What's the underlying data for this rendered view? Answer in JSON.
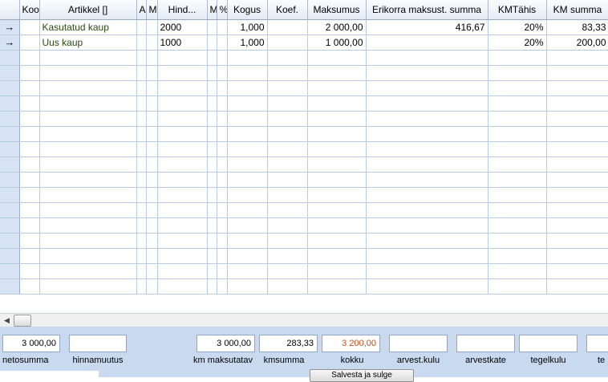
{
  "grid": {
    "columns": [
      "Koo",
      "Artikkel []",
      "A",
      "M",
      "Hind...",
      "M",
      "%",
      "Kogus",
      "Koef.",
      "Maksumus",
      "Erikorra maksust. summa",
      "KMTähis",
      "KM summa"
    ],
    "rows": [
      {
        "indicator": "→",
        "koo": "",
        "artikkel": "Kasutatud kaup",
        "a": "",
        "m": "",
        "hind": "2000",
        "m2": "",
        "pct": "",
        "kogus": "1,000",
        "koef": "",
        "maksumus": "2 000,00",
        "erikorra": "416,67",
        "kmtahis": "20%",
        "kmsumma": "83,33"
      },
      {
        "indicator": "→",
        "koo": "",
        "artikkel": "Uus kaup",
        "a": "",
        "m": "",
        "hind": "1000",
        "m2": "",
        "pct": "",
        "kogus": "1,000",
        "koef": "",
        "maksumus": "1 000,00",
        "erikorra": "",
        "kmtahis": "20%",
        "kmsumma": "200,00"
      }
    ]
  },
  "footer": {
    "netosumma": {
      "value": "3 000,00",
      "label": "netosumma"
    },
    "hinnamuutus": {
      "value": "",
      "label": "hinnamuutus"
    },
    "km_maksutatav": {
      "value": "3 000,00",
      "label": "km maksutatav"
    },
    "kmsumma": {
      "value": "283,33",
      "label": "kmsumma"
    },
    "kokku": {
      "value": "3 200,00",
      "label": "kokku"
    },
    "arvest_kulu": {
      "value": "",
      "label": "arvest.kulu"
    },
    "arvestkate": {
      "value": "",
      "label": "arvestkate"
    },
    "tegelkulu": {
      "value": "",
      "label": "tegelkulu"
    },
    "te": {
      "value": "",
      "label": "te"
    }
  },
  "bottom_button": "Salvesta ja sulge"
}
